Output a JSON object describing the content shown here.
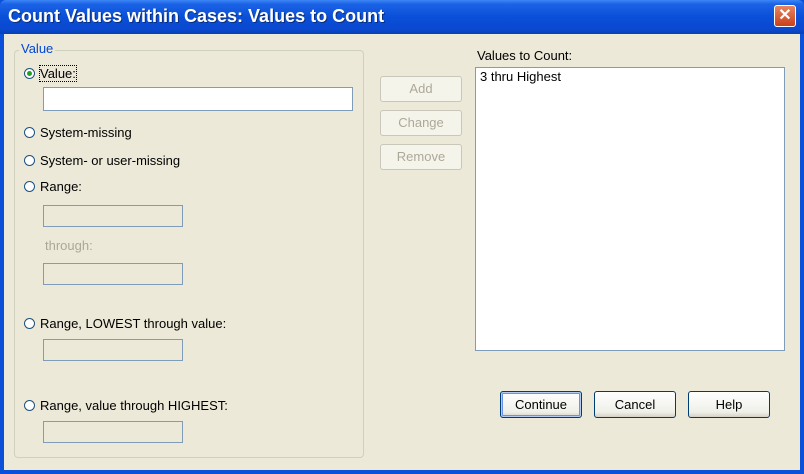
{
  "window": {
    "title": "Count Values within Cases: Values to Count",
    "close_symbol": "✕"
  },
  "value_group": {
    "legend": "Value",
    "value_option": "Value:",
    "system_missing_option": "System-missing",
    "system_or_user_missing_option": "System- or user-missing",
    "range_option": "Range:",
    "through_label": "through:",
    "range_lowest_option": "Range, LOWEST through value:",
    "range_highest_option": "Range, value through HIGHEST:",
    "selected_option": "Value:",
    "value_input": ""
  },
  "side_buttons": {
    "add": "Add",
    "change": "Change",
    "remove": "Remove"
  },
  "values_list": {
    "label": "Values to Count:",
    "items": [
      "3 thru Highest"
    ]
  },
  "bottom_buttons": {
    "continue": "Continue",
    "cancel": "Cancel",
    "help": "Help"
  },
  "colors": {
    "title_bar": "#0a50d8",
    "dialog_bg": "#ece9d8",
    "legend_text": "#0046d5",
    "disabled_text": "#aca899"
  }
}
